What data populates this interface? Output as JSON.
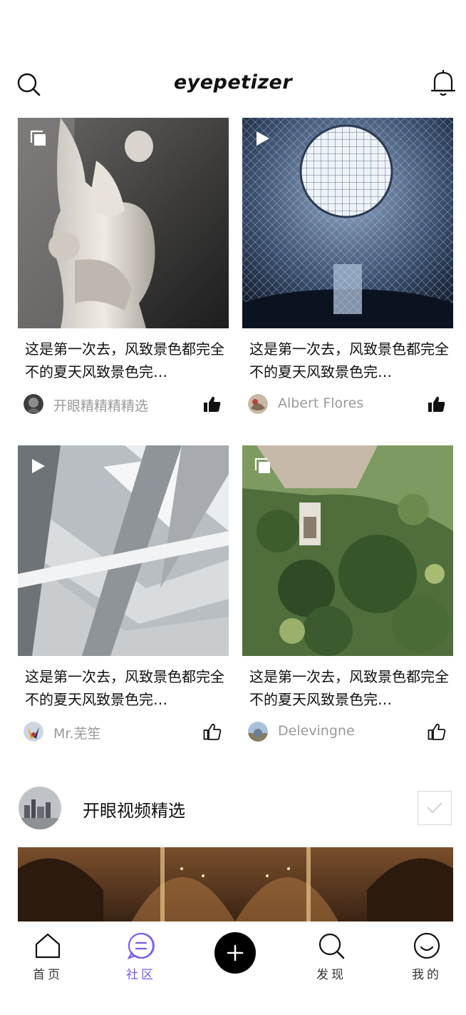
{
  "header": {
    "brand": "eyepetizer",
    "search_icon": "search-icon",
    "bell_icon": "bell-icon"
  },
  "cards": [
    {
      "title": "这是第一次去，风致景色都完全不的夏天风致景色完…",
      "author": "开眼精精精精选",
      "badge": "gallery-icon",
      "liked": true
    },
    {
      "title": "这是第一次去，风致景色都完全不的夏天风致景色完…",
      "author": "Albert Flores",
      "badge": "play-icon",
      "liked": true
    },
    {
      "title": "这是第一次去，风致景色都完全不的夏天风致景色完…",
      "author": "Mr.芜笙",
      "badge": "play-icon",
      "liked": false
    },
    {
      "title": "这是第一次去，风致景色都完全不的夏天风致景色完…",
      "author": "Delevingne",
      "badge": "gallery-icon",
      "liked": false
    }
  ],
  "recommend": {
    "name": "开眼视频精选",
    "checked": false
  },
  "tabbar": {
    "items": [
      {
        "label": "首页",
        "icon": "home-icon",
        "active": false
      },
      {
        "label": "社区",
        "icon": "community-icon",
        "active": true
      },
      {
        "label": "",
        "icon": "plus-icon",
        "active": false
      },
      {
        "label": "发现",
        "icon": "discover-search-icon",
        "active": false
      },
      {
        "label": "我的",
        "icon": "profile-smile-icon",
        "active": false
      }
    ]
  },
  "colors": {
    "accent": "#7b5cf0",
    "text": "#111111",
    "muted": "#9a9a9a"
  }
}
